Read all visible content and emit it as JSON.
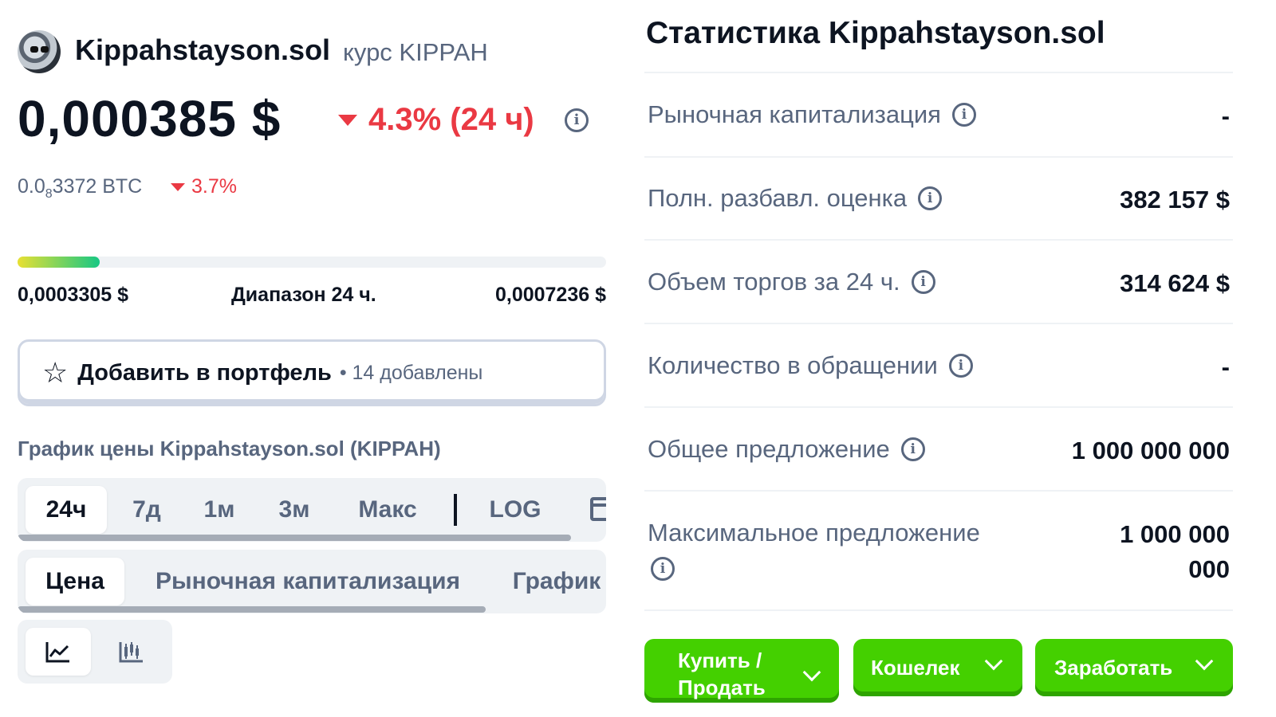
{
  "coin": {
    "name": "Kippahstayson.sol",
    "subtitle": "курс KIPPAH",
    "price": "0,000385 $",
    "change_24h": "4.3% (24 ч)",
    "btc_prefix": "0.0",
    "btc_sub": "8",
    "btc_rest": "3372 BTC",
    "btc_change": "3.7%",
    "range_progress_fraction": 0.14,
    "range_low": "0,0003305 $",
    "range_label": "Диапазон 24 ч.",
    "range_high": "0,0007236 $"
  },
  "portfolio": {
    "label": "Добавить в портфель",
    "count": "• 14 добавлены"
  },
  "chart": {
    "title": "График цены Kippahstayson.sol (KIPPAH)",
    "range_tabs": [
      "24ч",
      "7д",
      "1м",
      "3м",
      "Макс",
      "LOG"
    ],
    "type_tabs": [
      "Цена",
      "Рыночная капитализация",
      "График"
    ]
  },
  "stats": {
    "title": "Статистика Kippahstayson.sol",
    "rows": [
      {
        "label": "Рыночная капитализация",
        "value": "-"
      },
      {
        "label": "Полн. разбавл. оценка",
        "value": "382 157 $"
      },
      {
        "label": "Объем торгов за 24 ч.",
        "value": "314 624 $"
      },
      {
        "label": "Количество в обращении",
        "value": "-"
      },
      {
        "label": "Общее предложение",
        "value": "1 000 000 000"
      },
      {
        "label": "Максимальное предложение",
        "value_line1": "1 000 000",
        "value_line2": "000"
      }
    ]
  },
  "actions": {
    "buy_sell_line1": "Купить /",
    "buy_sell_line2": "Продать",
    "wallet": "Кошелек",
    "earn": "Заработать"
  },
  "colors": {
    "negative": "#ea3943",
    "accent_green": "#44d000",
    "muted": "#58667e",
    "text": "#0d1421"
  }
}
